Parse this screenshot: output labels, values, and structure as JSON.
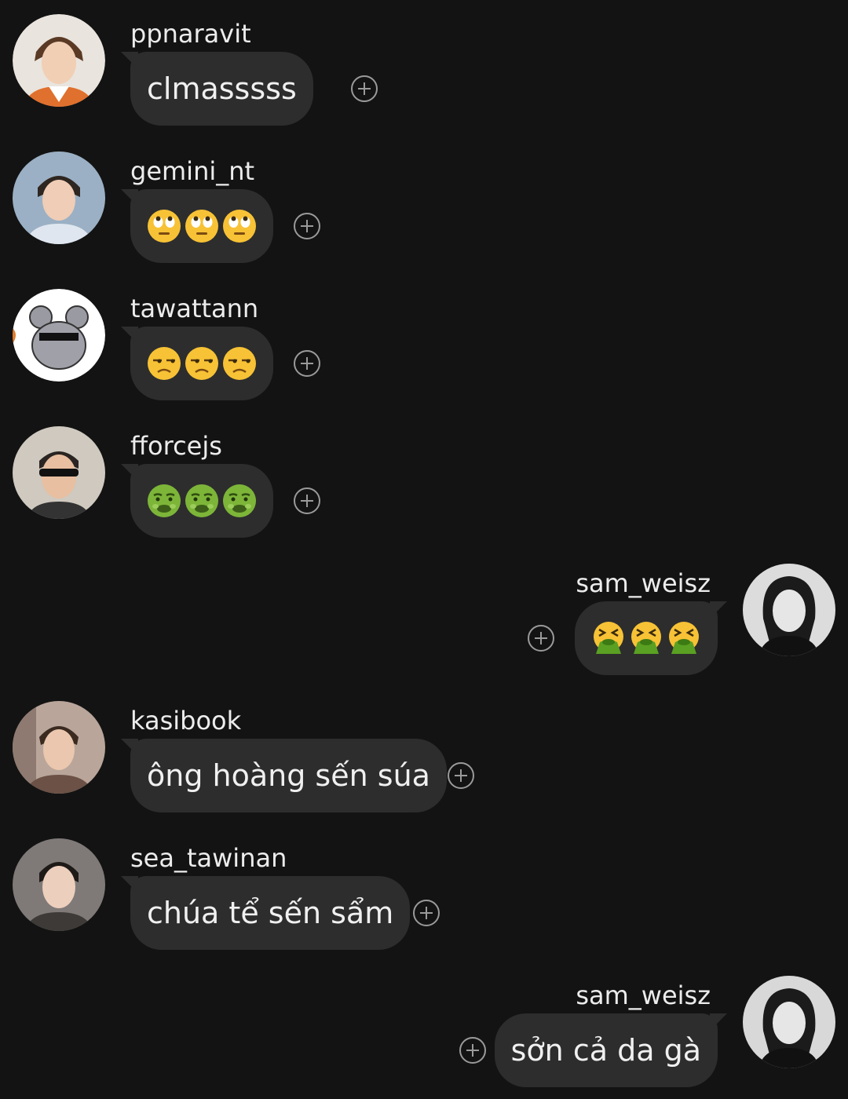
{
  "messages": [
    {
      "side": "left",
      "username": "ppnaravit",
      "text": "clmasssss",
      "emoji": null,
      "avatar": "avatar-ppnaravit"
    },
    {
      "side": "left",
      "username": "gemini_nt",
      "text": "",
      "emoji": [
        "face-with-rolling-eyes",
        "face-with-rolling-eyes",
        "face-with-rolling-eyes"
      ],
      "avatar": "avatar-gemini_nt"
    },
    {
      "side": "left",
      "username": "tawattann",
      "text": "",
      "emoji": [
        "unamused-face",
        "unamused-face",
        "unamused-face"
      ],
      "avatar": "avatar-tawattann"
    },
    {
      "side": "left",
      "username": "fforcejs",
      "text": "",
      "emoji": [
        "nauseated-face",
        "nauseated-face",
        "nauseated-face"
      ],
      "avatar": "avatar-fforcejs"
    },
    {
      "side": "right",
      "username": "sam_weisz",
      "text": "",
      "emoji": [
        "face-vomiting",
        "face-vomiting",
        "face-vomiting"
      ],
      "avatar": "avatar-sam_weisz"
    },
    {
      "side": "left",
      "username": "kasibook",
      "text": "ông hoàng sến súa",
      "emoji": null,
      "avatar": "avatar-kasibook"
    },
    {
      "side": "left",
      "username": "sea_tawinan",
      "text": "chúa tể sến sẩm",
      "emoji": null,
      "avatar": "avatar-sea_tawinan"
    },
    {
      "side": "right",
      "username": "sam_weisz",
      "text": "sởn cả da gà",
      "emoji": null,
      "avatar": "avatar-sam_weisz"
    }
  ],
  "icons": {
    "react": "add-reaction-icon"
  },
  "colors": {
    "background": "#131313",
    "bubble": "#2d2d2d",
    "text": "#f0f0f0",
    "icon": "#9a9a9a"
  }
}
